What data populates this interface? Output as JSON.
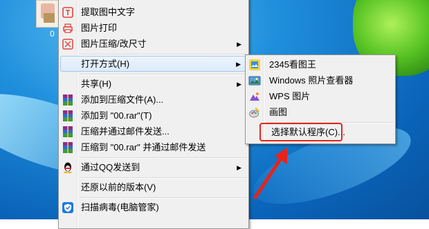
{
  "desktop": {
    "icon_label": "0"
  },
  "main_menu": {
    "items": [
      {
        "label": "提取图中文字",
        "icon": "text-extract-icon"
      },
      {
        "label": "图片打印",
        "icon": "printer-icon"
      },
      {
        "label": "图片压缩/改尺寸",
        "icon": "compress-icon",
        "submenu": true
      },
      {
        "label": "打开方式(H)",
        "submenu": true,
        "highlighted": true
      },
      {
        "label": "共享(H)",
        "submenu": true
      },
      {
        "label": "添加到压缩文件(A)...",
        "icon": "winrar-icon"
      },
      {
        "label": "添加到 \"00.rar\"(T)",
        "icon": "winrar-icon"
      },
      {
        "label": "压缩并通过邮件发送...",
        "icon": "winrar-icon"
      },
      {
        "label": "压缩到 \"00.rar\" 并通过邮件发送",
        "icon": "winrar-icon"
      },
      {
        "label": "通过QQ发送到",
        "icon": "qq-penguin-icon",
        "submenu": true
      },
      {
        "label": "还原以前的版本(V)"
      },
      {
        "label": "扫描病毒(电脑管家)",
        "icon": "shield-icon"
      }
    ],
    "arrow": "▶"
  },
  "open_with_menu": {
    "items": [
      {
        "label": "2345看图王",
        "icon": "2345-viewer-icon"
      },
      {
        "label": "Windows 照片查看器",
        "icon": "photo-viewer-icon"
      },
      {
        "label": "WPS 图片",
        "icon": "wps-picture-icon"
      },
      {
        "label": "画图",
        "icon": "paint-icon"
      },
      {
        "label": "选择默认程序(C)...",
        "highlighted_by_annotation": true
      }
    ]
  },
  "colors": {
    "annotation": "#e8231b",
    "hover_fill": "#dcebfc",
    "menu_bg": "#f0f0f0"
  }
}
